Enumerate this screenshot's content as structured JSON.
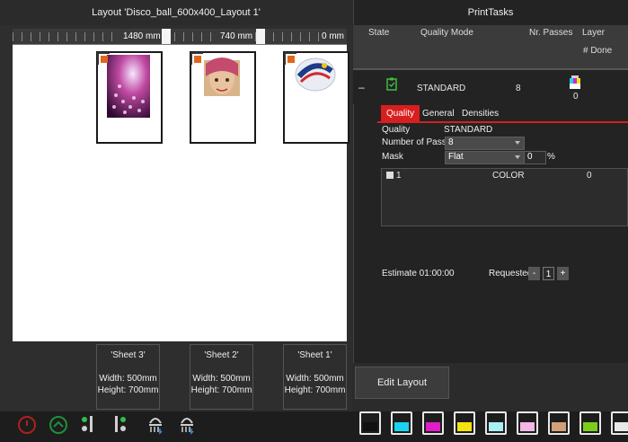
{
  "layout": {
    "title": "Layout 'Disco_ball_600x400_Layout 1'",
    "ruler": {
      "labels": [
        "1480 mm",
        "740 mm",
        "0 mm"
      ]
    },
    "sheets": [
      {
        "name": "'Sheet 3'",
        "width": "Width: 500mm",
        "height": "Height: 700mm",
        "image": "disco-ball-image"
      },
      {
        "name": "'Sheet 2'",
        "width": "Width: 500mm",
        "height": "Height: 700mm",
        "image": "portrait-image"
      },
      {
        "name": "'Sheet 1'",
        "width": "Width: 500mm",
        "height": "Height: 700mm",
        "image": "logo-image"
      }
    ]
  },
  "tasks": {
    "title": "PrintTasks",
    "columns": {
      "state": "State",
      "quality_mode": "Quality Mode",
      "passes": "Nr. Passes",
      "layer": "Layer",
      "done": "# Done"
    },
    "row": {
      "collapse": "–",
      "quality": "STANDARD",
      "passes": "8",
      "done": "0"
    },
    "tabs": [
      "Quality",
      "General",
      "Densities"
    ],
    "quality_label": "Quality",
    "quality_value": "STANDARD",
    "passes_label": "Number of Passes",
    "passes_value": "8",
    "mask_label": "Mask",
    "mask_value": "Flat",
    "mask_amount": "0",
    "mask_unit": "%",
    "mask_list": {
      "index": "1",
      "color": "COLOR",
      "value": "0"
    },
    "estimate": "Estimate 01:00:00",
    "requested_label": "Requested",
    "requested_minus": "-",
    "requested_value": "1",
    "requested_plus": "+"
  },
  "edit_layout": "Edit Layout",
  "accent": "#d81e1e",
  "inks": [
    {
      "name": "black",
      "color": "#111111"
    },
    {
      "name": "cyan",
      "color": "#19d3f0"
    },
    {
      "name": "magenta",
      "color": "#e01ec8"
    },
    {
      "name": "yellow",
      "color": "#f3e30e"
    },
    {
      "name": "light-cyan",
      "color": "#a9eef7"
    },
    {
      "name": "light-magenta",
      "color": "#f2b6e8"
    },
    {
      "name": "orange-tan",
      "color": "#d1a07a"
    },
    {
      "name": "green",
      "color": "#7ccd1b"
    },
    {
      "name": "white",
      "color": "#e8e8e8"
    }
  ]
}
